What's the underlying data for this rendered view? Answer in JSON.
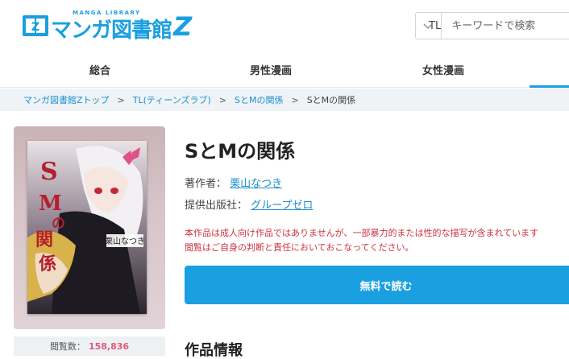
{
  "header": {
    "logo_sub": "MANGA LIBRARY",
    "logo_text": "マンガ図書館",
    "logo_z": "Z",
    "search_select": "TL",
    "search_placeholder": "キーワードで検索"
  },
  "nav": {
    "tabs": [
      {
        "label": "総合"
      },
      {
        "label": "男性漫画"
      },
      {
        "label": "女性漫画"
      }
    ]
  },
  "breadcrumb": {
    "items": [
      {
        "label": "マンガ図書館Zトップ"
      },
      {
        "label": "TL(ティーンズラブ)"
      },
      {
        "label": "SとMの関係"
      }
    ],
    "current": "SとMの関係",
    "separator": ">"
  },
  "book": {
    "title": "SとMの関係",
    "author_label": "著作者：",
    "author": "栗山なつき",
    "publisher_label": "提供出版社：",
    "publisher": "グループゼロ",
    "warning_line1": "本作品は成人向け作品ではありませんが、一部暴力的または性的な描写が含まれています",
    "warning_line2": "閲覧はご自身の判断と責任においておこなってください。",
    "read_button": "無料で読む",
    "views_label": "閲覧数：",
    "views_count": "158,836",
    "cover_author": "栗山なつき"
  },
  "section": {
    "info_title": "作品情報"
  },
  "colors": {
    "accent": "#1a9fe0",
    "warning": "#d0323a",
    "views_number": "#e05a7a"
  }
}
